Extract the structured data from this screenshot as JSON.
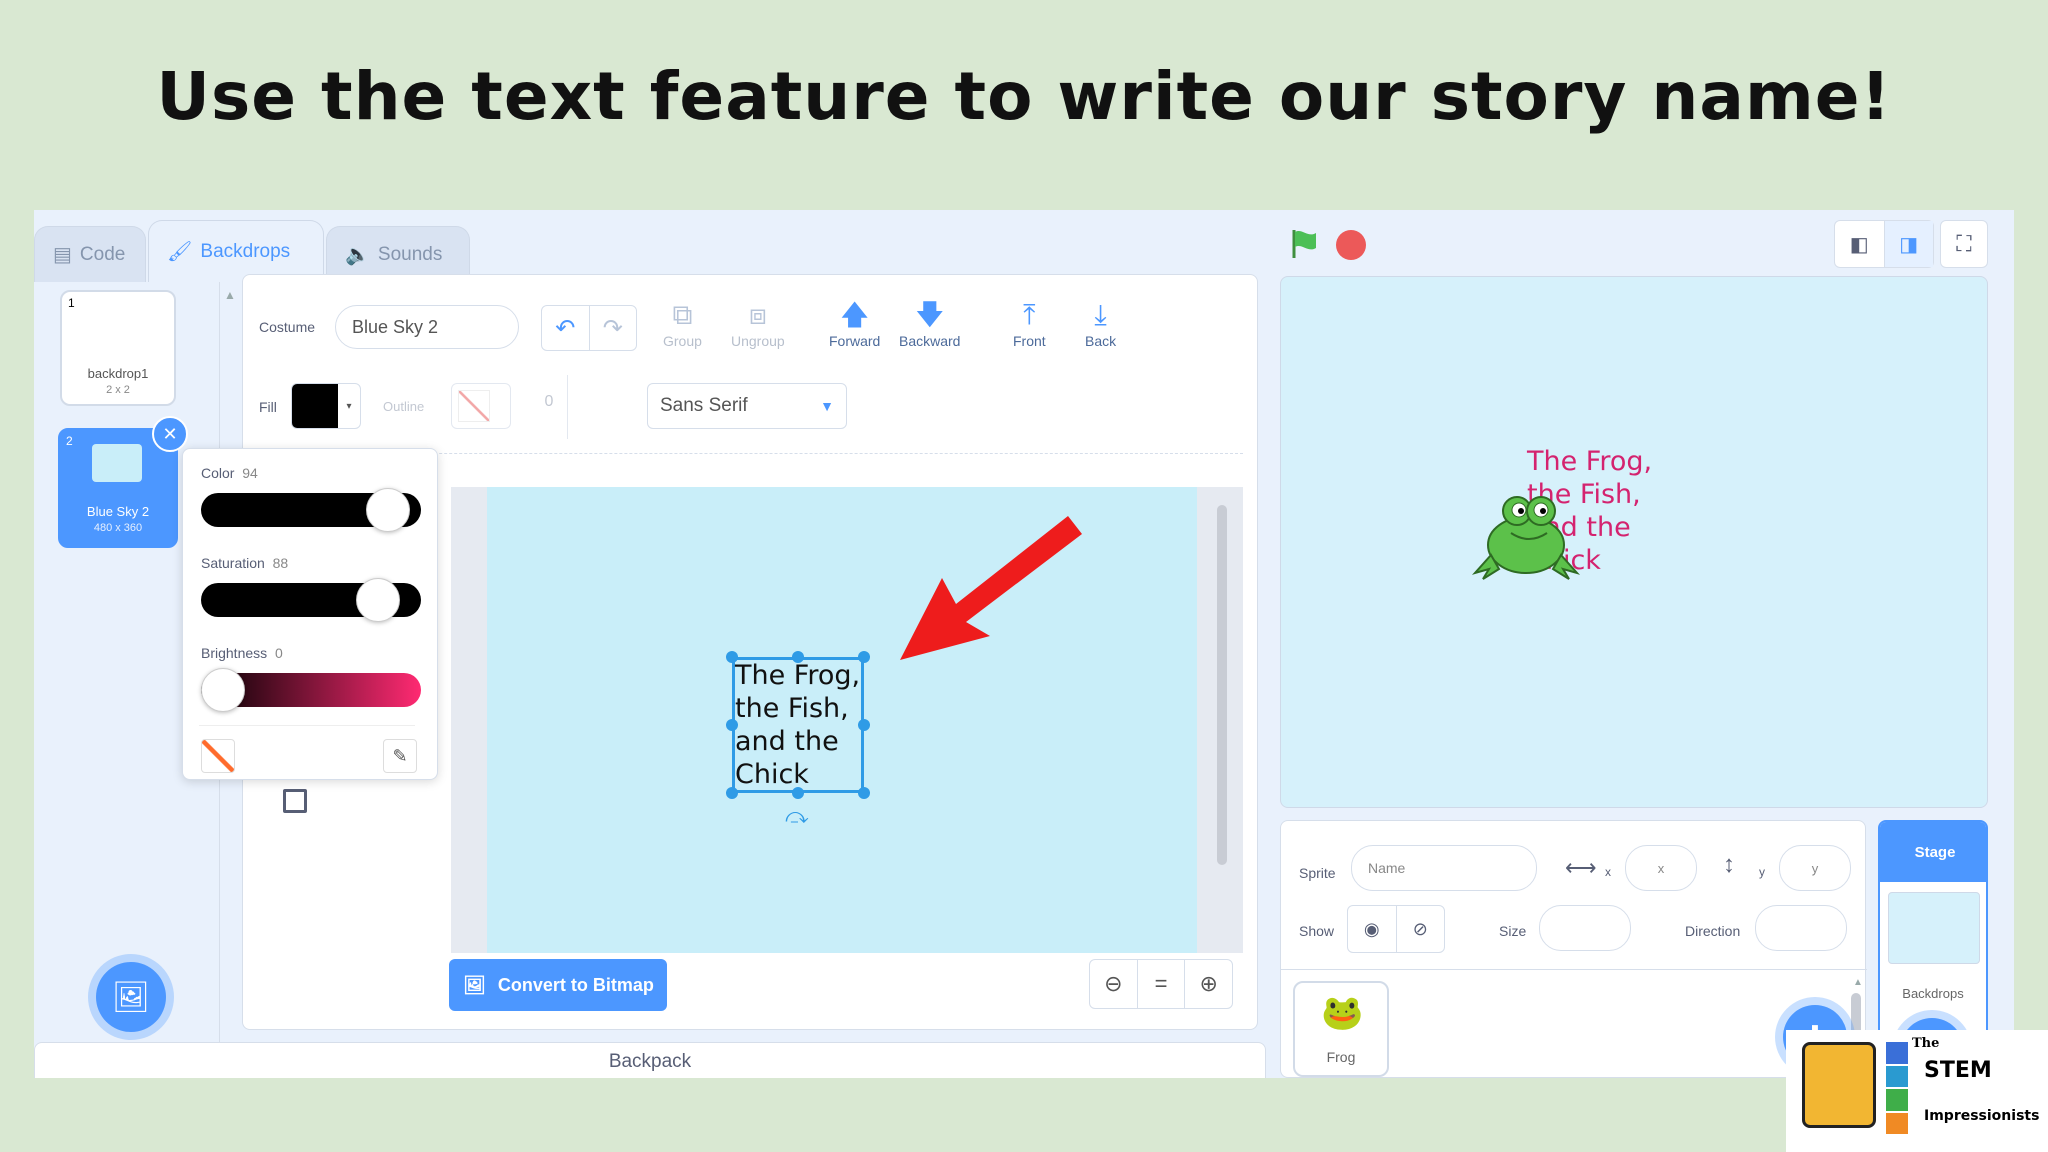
{
  "slide": {
    "title": "Use the text feature to write our story name!"
  },
  "tabs": {
    "code": "Code",
    "backdrops": "Backdrops",
    "sounds": "Sounds"
  },
  "backdrop_list": [
    {
      "num": "1",
      "name": "backdrop1",
      "size": "2 x 2"
    },
    {
      "num": "2",
      "name": "Blue Sky 2",
      "size": "480 x 360"
    }
  ],
  "editor": {
    "costume_label": "Costume",
    "costume_name": "Blue Sky 2",
    "tools": {
      "group": "Group",
      "ungroup": "Ungroup",
      "forward": "Forward",
      "backward": "Backward",
      "front": "Front",
      "back": "Back"
    },
    "fill_label": "Fill",
    "fill_color": "#000000",
    "outline_label": "Outline",
    "outline_width": "0",
    "font": "Sans Serif",
    "convert_button": "Convert to Bitmap",
    "canvas_text": "The Frog,\nthe Fish,\nand the\nChick"
  },
  "color_picker": {
    "color_label": "Color",
    "color_value": "94",
    "saturation_label": "Saturation",
    "saturation_value": "88",
    "brightness_label": "Brightness",
    "brightness_value": "0",
    "color_level": 0.94,
    "saturation_level": 0.88,
    "brightness_level": 0.0
  },
  "backpack": {
    "label": "Backpack"
  },
  "stage": {
    "text": "The Frog,\nthe Fish,\nand the\nChick",
    "text_color": "#d4236f"
  },
  "sprite_info": {
    "sprite_label": "Sprite",
    "name_placeholder": "Name",
    "x_label": "x",
    "x_placeholder": "x",
    "y_label": "y",
    "y_placeholder": "y",
    "show_label": "Show",
    "size_label": "Size",
    "direction_label": "Direction"
  },
  "sprites": [
    {
      "name": "Frog"
    }
  ],
  "stage_panel": {
    "title": "Stage",
    "backdrops_label": "Backdrops"
  },
  "logo": {
    "line1": "The",
    "line2": "STEM",
    "line3": "Impressionists"
  },
  "colors": {
    "accent": "#4c97ff",
    "arrow": "#ee1c1c",
    "canvas": "#c9eef9",
    "stage": "#d6f1fb"
  }
}
